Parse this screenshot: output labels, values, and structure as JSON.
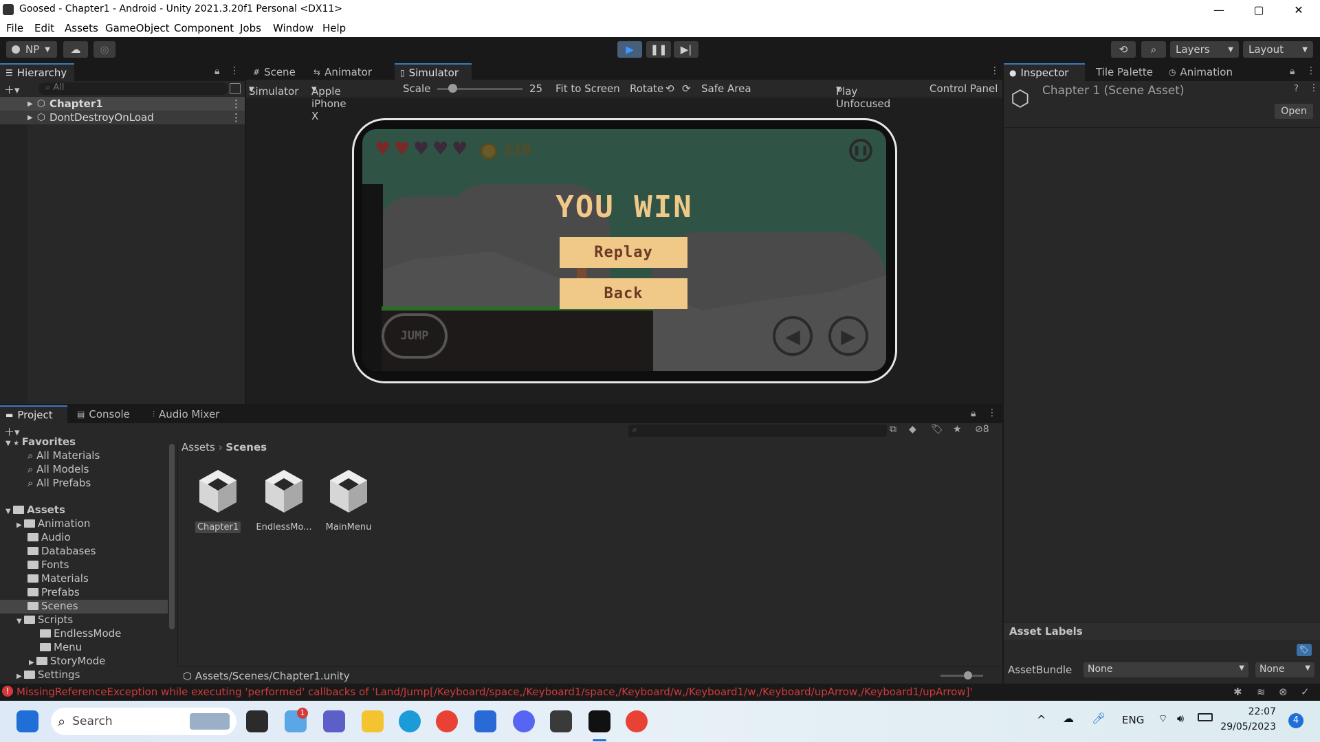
{
  "window": {
    "title": "Goosed - Chapter1 - Android - Unity 2021.3.20f1 Personal <DX11>",
    "minimize": "—",
    "maximize": "▢",
    "close": "✕"
  },
  "menu": [
    "File",
    "Edit",
    "Assets",
    "GameObject",
    "Component",
    "Jobs",
    "Window",
    "Help"
  ],
  "toolbar": {
    "account": "NP",
    "layers": "Layers",
    "layout": "Layout"
  },
  "hierarchy": {
    "tab": "Hierarchy",
    "search_placeholder": "All",
    "items": [
      "Chapter1",
      "DontDestroyOnLoad"
    ]
  },
  "center_tabs": [
    "Scene",
    "Animator",
    "Simulator"
  ],
  "simulator": {
    "mode": "Simulator",
    "device": "Apple iPhone X",
    "scale_label": "Scale",
    "scale_value": "25",
    "fit": "Fit to Screen",
    "rotate": "Rotate",
    "safe_area": "Safe Area",
    "play_mode": "Play Unfocused",
    "control_panel": "Control Panel"
  },
  "game": {
    "coins": "116",
    "title": "YOU WIN",
    "replay": "Replay",
    "back": "Back",
    "jump": "JUMP",
    "hearts_full": 2,
    "hearts_total": 5
  },
  "right_tabs": [
    "Inspector",
    "Tile Palette",
    "Animation"
  ],
  "inspector": {
    "title": "Chapter 1 (Scene Asset)",
    "open": "Open",
    "asset_labels": "Asset Labels",
    "asset_bundle_label": "AssetBundle",
    "asset_bundle_value": "None",
    "variant_value": "None"
  },
  "bottom_tabs": [
    "Project",
    "Console",
    "Audio Mixer"
  ],
  "project": {
    "favorites": "Favorites",
    "favorite_items": [
      "All Materials",
      "All Models",
      "All Prefabs"
    ],
    "assets_root": "Assets",
    "folders": [
      "Animation",
      "Audio",
      "Databases",
      "Fonts",
      "Materials",
      "Prefabs",
      "Scenes",
      "Scripts"
    ],
    "script_subfolders": [
      "EndlessMode",
      "Menu",
      "StoryMode"
    ],
    "settings": "Settings",
    "breadcrumb": [
      "Assets",
      "Scenes"
    ],
    "assets": [
      "Chapter1",
      "EndlessMo...",
      "MainMenu"
    ],
    "path": "Assets/Scenes/Chapter1.unity",
    "hidden_count": "8"
  },
  "status": {
    "error": "MissingReferenceException while executing 'performed' callbacks of 'Land/Jump[/Keyboard/space,/Keyboard1/space,/Keyboard/w,/Keyboard1/w,/Keyboard/upArrow,/Keyboard1/upArrow]'"
  },
  "taskbar": {
    "search": "Search",
    "language": "ENG",
    "time": "22:07",
    "date": "29/05/2023",
    "notification_count": "4",
    "weather_badge": "1"
  }
}
